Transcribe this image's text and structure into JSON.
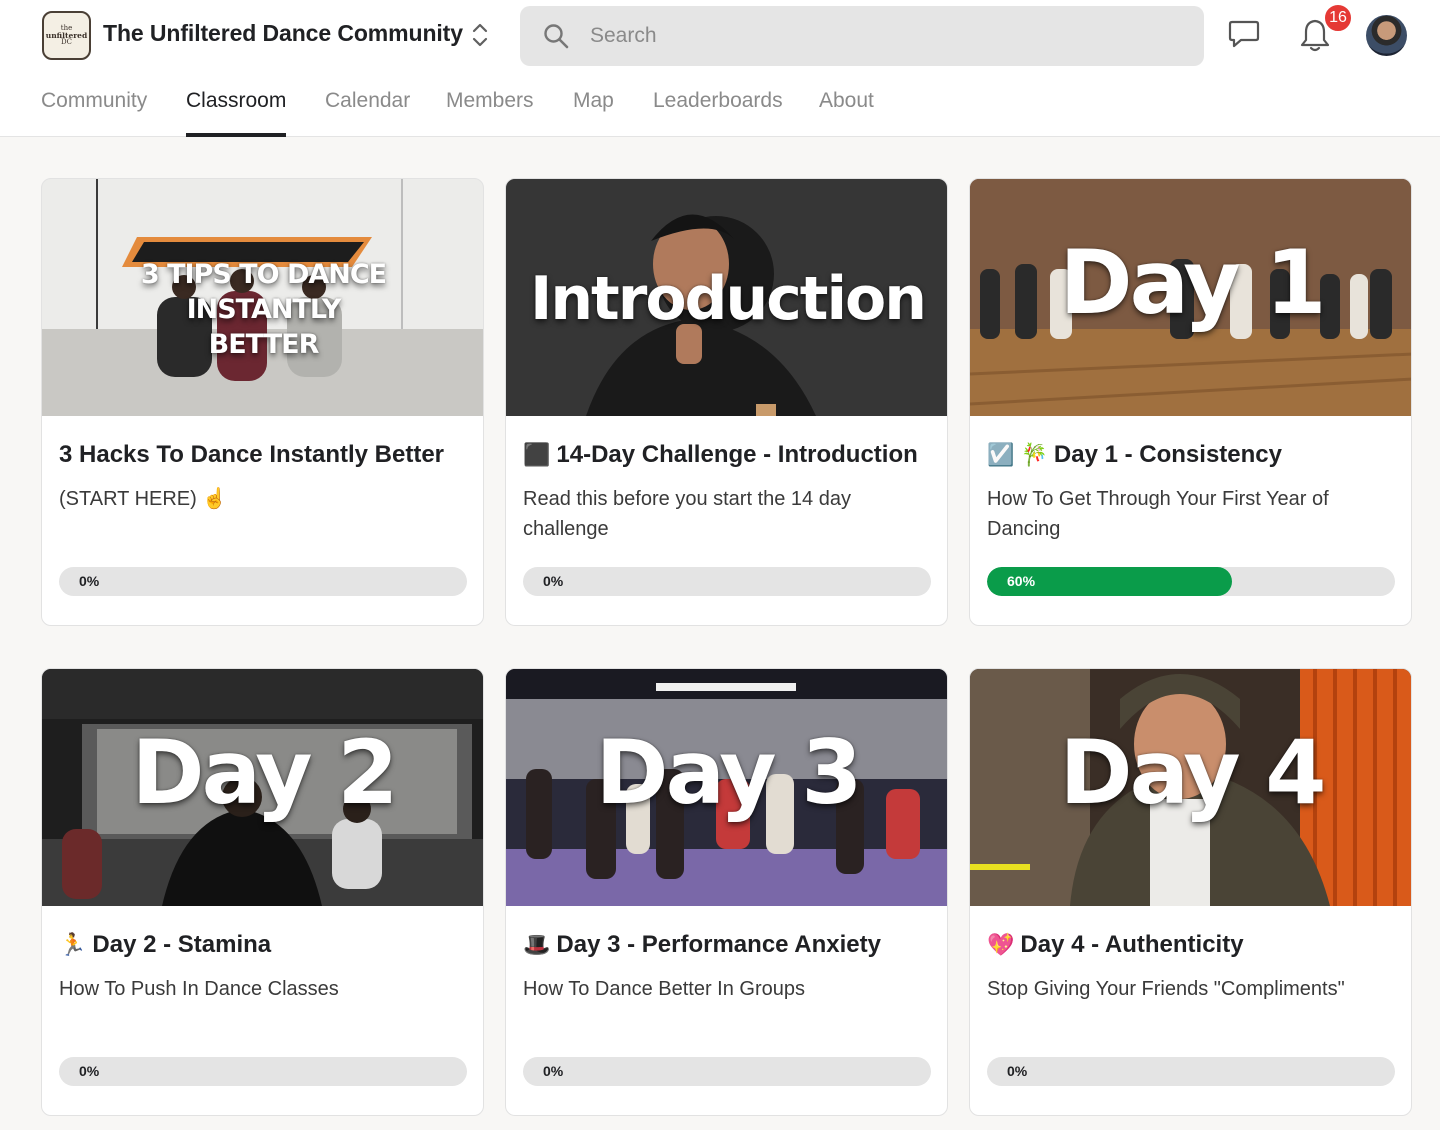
{
  "header": {
    "logo_lines": [
      "the",
      "unfiltered",
      "DC"
    ],
    "community_name": "The Unfiltered Dance Community",
    "search_placeholder": "Search",
    "notification_count": "16",
    "icons": {
      "switcher": "chevron-up-down-icon",
      "search": "search-icon",
      "chat": "chat-icon",
      "notifications": "bell-icon",
      "avatar": "user-avatar"
    }
  },
  "tabs": [
    {
      "label": "Community",
      "active": false
    },
    {
      "label": "Classroom",
      "active": true
    },
    {
      "label": "Calendar",
      "active": false
    },
    {
      "label": "Members",
      "active": false
    },
    {
      "label": "Map",
      "active": false
    },
    {
      "label": "Leaderboards",
      "active": false
    },
    {
      "label": "About",
      "active": false
    }
  ],
  "courses": [
    {
      "thumb_text": "3 TIPS TO DANCE INSTANTLY BETTER",
      "title": "3 Hacks To Dance Instantly Better",
      "description": "(START HERE) ☝️",
      "progress_label": "0%",
      "progress": 0
    },
    {
      "thumb_text": "Introduction",
      "emoji": "⬛",
      "title": "14-Day Challenge - Introduction",
      "description": "Read this before you start the 14 day challenge",
      "progress_label": "0%",
      "progress": 0
    },
    {
      "thumb_text": "Day 1",
      "emoji": "☑️ 🎋",
      "title": "Day 1 - Consistency",
      "description": "How To Get Through Your First Year of Dancing",
      "progress_label": "60%",
      "progress": 0.6
    },
    {
      "thumb_text": "Day 2",
      "emoji": "🏃",
      "title": "Day 2 - Stamina",
      "description": "How To Push In Dance Classes",
      "progress_label": "0%",
      "progress": 0
    },
    {
      "thumb_text": "Day 3",
      "emoji": "🎩",
      "title": "Day 3 - Performance Anxiety",
      "description": "How To Dance Better In Groups",
      "progress_label": "0%",
      "progress": 0
    },
    {
      "thumb_text": "Day 4",
      "emoji": "💖",
      "title": "Day 4 - Authenticity",
      "description": "Stop Giving Your Friends \"Compliments\"",
      "progress_label": "0%",
      "progress": 0
    }
  ],
  "colors": {
    "progress_complete": "#0a9c4a",
    "progress_track": "#e4e4e4",
    "badge": "#e53935"
  }
}
